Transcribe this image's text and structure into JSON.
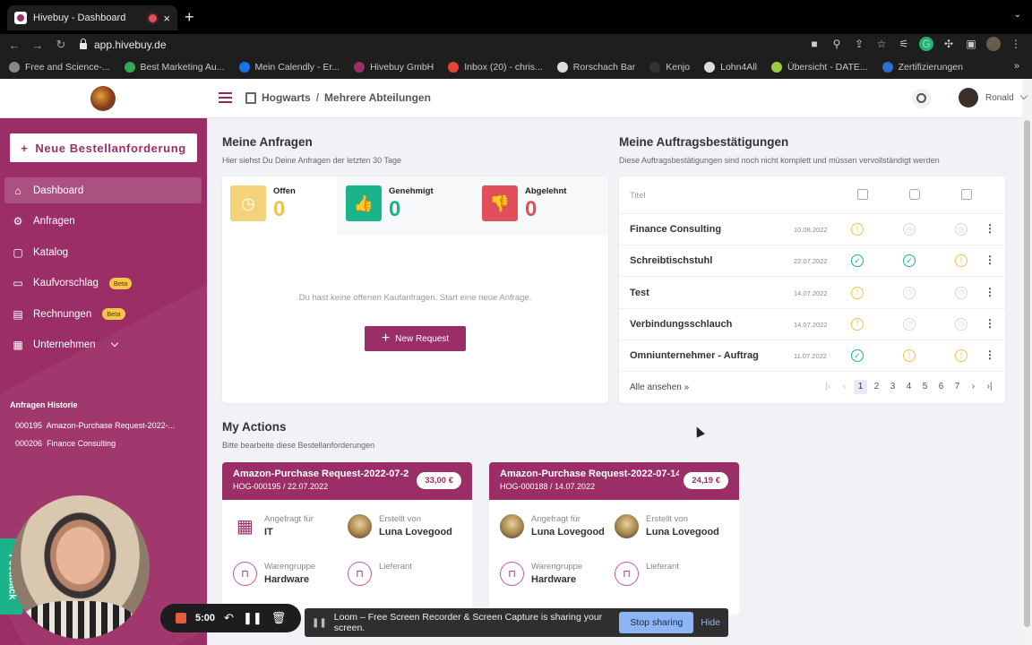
{
  "browser": {
    "tab_title": "Hivebuy - Dashboard",
    "tab_close": "×",
    "new_tab": "+",
    "url": "app.hivebuy.de",
    "bookmarks": [
      {
        "label": "Free and Science-...",
        "color": "#888888"
      },
      {
        "label": "Best Marketing Au...",
        "color": "#34a853"
      },
      {
        "label": "Mein Calendly - Er...",
        "color": "#1a73e8"
      },
      {
        "label": "Hivebuy GmbH",
        "color": "#9b2e66"
      },
      {
        "label": "Inbox (20) - chris...",
        "color": "#ea4335"
      },
      {
        "label": "Rorschach Bar",
        "color": "#dddddd"
      },
      {
        "label": "Kenjo",
        "color": "#333333"
      },
      {
        "label": "Lohn4All",
        "color": "#dddddd"
      },
      {
        "label": "Übersicht - DATE...",
        "color": "#9ccc40"
      },
      {
        "label": "Zertifizierungen",
        "color": "#2e6fd1"
      }
    ],
    "bookmarks_more": "»"
  },
  "header": {
    "breadcrumb_company": "Hogwarts",
    "breadcrumb_sep": "/",
    "breadcrumb_dept": "Mehrere Abteilungen",
    "user_name": "Ronald"
  },
  "sidebar": {
    "new_button": "Neue Bestellanforderung",
    "new_button_icon": "+",
    "items": [
      {
        "label": "Dashboard",
        "icon": "⌂"
      },
      {
        "label": "Anfragen",
        "icon": "⚙"
      },
      {
        "label": "Katalog",
        "icon": "▢"
      },
      {
        "label": "Kaufvorschlag",
        "icon": "▭",
        "badge": "Beta"
      },
      {
        "label": "Rechnungen",
        "icon": "▤",
        "badge": "Beta"
      },
      {
        "label": "Unternehmen",
        "icon": "▦"
      }
    ],
    "history_title": "Anfragen Historie",
    "history": [
      {
        "id": "000195",
        "label": "Amazon-Purchase Request-2022-..."
      },
      {
        "id": "000206",
        "label": "Finance Consulting"
      }
    ]
  },
  "requests": {
    "title": "Meine Anfragen",
    "subtitle": "Hier siehst Du Deine Anfragen der letzten 30 Tage",
    "stats": [
      {
        "label": "Offen",
        "value": "0",
        "color": "#f3d27a",
        "text_color": "#f2c34a",
        "icon": "◷"
      },
      {
        "label": "Genehmigt",
        "value": "0",
        "color": "#1bb38a",
        "text_color": "#1bb38a",
        "icon": "👍"
      },
      {
        "label": "Abgelehnt",
        "value": "0",
        "color": "#e0505a",
        "text_color": "#e0505a",
        "icon": "👎"
      }
    ],
    "empty_text": "Du hast keine offenen Kaufanfragen. Start eine neue Anfrage.",
    "new_request_label": "New Request",
    "new_request_icon": "+"
  },
  "orders": {
    "title": "Meine Auftragsbestätigungen",
    "subtitle": "Diese Auftragsbestätigungen sind noch nicht komplett und müssen vervollständigt werden",
    "col_title": "Titel",
    "rows": [
      {
        "name": "Finance Consulting",
        "date": "10.08.2022",
        "s1": "y",
        "s2": "n",
        "s3": "n"
      },
      {
        "name": "Schreibtischstuhl",
        "date": "22.07.2022",
        "s1": "g",
        "s2": "g",
        "s3": "y"
      },
      {
        "name": "Test",
        "date": "14.07.2022",
        "s1": "y",
        "s2": "n",
        "s3": "n"
      },
      {
        "name": "Verbindungsschlauch",
        "date": "14.07.2022",
        "s1": "y",
        "s2": "n",
        "s3": "n"
      },
      {
        "name": "Omniunternehmer - Auftrag",
        "date": "11.07.2022",
        "s1": "g",
        "s2": "y",
        "s3": "y"
      }
    ],
    "view_all": "Alle ansehen »",
    "pages": [
      "1",
      "2",
      "3",
      "4",
      "5",
      "6",
      "7"
    ],
    "current_page": "1"
  },
  "actions": {
    "title": "My Actions",
    "subtitle": "Bitte bearbeite diese Bestellanforderungen",
    "cards": [
      {
        "title": "Amazon-Purchase Request-2022-07-2",
        "sub": "HOG-000195 / 22.07.2022",
        "price": "33,00 €",
        "requested_for_label": "Angefragt für",
        "requested_for": "IT",
        "created_by_label": "Erstellt von",
        "created_by": "Luna Lovegood",
        "group_label": "Warengruppe",
        "group": "Hardware",
        "supplier_label": "Lieferant",
        "supplier": ""
      },
      {
        "title": "Amazon-Purchase Request-2022-07-14",
        "sub": "HOG-000188 / 14.07.2022",
        "price": "24,19 €",
        "requested_for_label": "Angefragt für",
        "requested_for": "Luna Lovegood",
        "created_by_label": "Erstellt von",
        "created_by": "Luna Lovegood",
        "group_label": "Warengruppe",
        "group": "Hardware",
        "supplier_label": "Lieferant",
        "supplier": ""
      }
    ]
  },
  "feedback_label": "Feedback",
  "loom": {
    "time": "5:00",
    "message": "Loom – Free Screen Recorder & Screen Capture is sharing your screen.",
    "stop_label": "Stop sharing",
    "hide_label": "Hide"
  }
}
